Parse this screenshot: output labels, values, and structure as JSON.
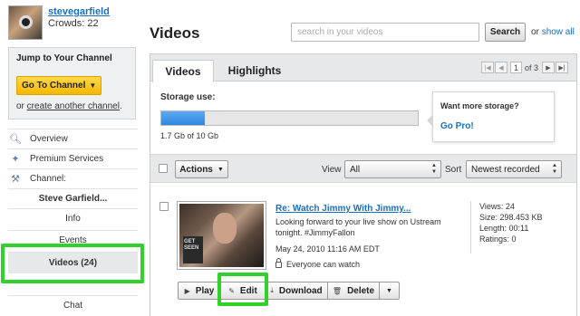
{
  "user": {
    "username": "stevegarfield",
    "crowds": "Crowds: 22"
  },
  "sidebar": {
    "jump_title": "Jump to Your Channel",
    "go_button": "Go To Channel",
    "create_prefix": "or ",
    "create_link": "create another channel",
    "create_suffix": ".",
    "nav": [
      {
        "label": "Overview",
        "icon": "search-icon"
      },
      {
        "label": "Premium Services",
        "icon": "star-icon"
      },
      {
        "label": "Channel:",
        "icon": "tools-icon"
      }
    ],
    "channel_name": "Steve Garfield...",
    "sub_items": [
      "Info",
      "Events",
      "Videos (24)",
      "Chat"
    ]
  },
  "header": {
    "title": "Videos",
    "search_placeholder": "search in your videos",
    "search_button": "Search",
    "or_text": "or",
    "show_all": "show all"
  },
  "tabs": [
    "Videos",
    "Highlights"
  ],
  "pager": {
    "current": "1",
    "of_text": "of 3"
  },
  "storage": {
    "label": "Storage use:",
    "used_fraction": 0.17,
    "text": "1.7 Gb of 10 Gb"
  },
  "pro": {
    "title": "Want more storage?",
    "link": "Go Pro!"
  },
  "toolbar": {
    "actions": "Actions",
    "view_label": "View",
    "view_value": "All",
    "sort_label": "Sort",
    "sort_value": "Newest recorded"
  },
  "video": {
    "title": "Re: Watch Jimmy With Jimmy...",
    "description": "Looking forward to your live show on Ustream tonight. #JimmyFallon",
    "date": "May 24, 2010 11:16 AM EDT",
    "privacy": "Everyone can watch",
    "thumb_sign": "GET SEEN",
    "stats": {
      "views": "Views: 24",
      "size": "Size: 298.453 KB",
      "length": "Length: 00:11",
      "ratings": "Ratings: 0"
    },
    "actions": {
      "play": "Play",
      "edit": "Edit",
      "download": "Download",
      "delete": "Delete"
    }
  },
  "colors": {
    "highlight": "#2fd12a",
    "link": "#1a6fc2",
    "go_button": "#f4b800",
    "storage_fill": "#2f86df"
  }
}
